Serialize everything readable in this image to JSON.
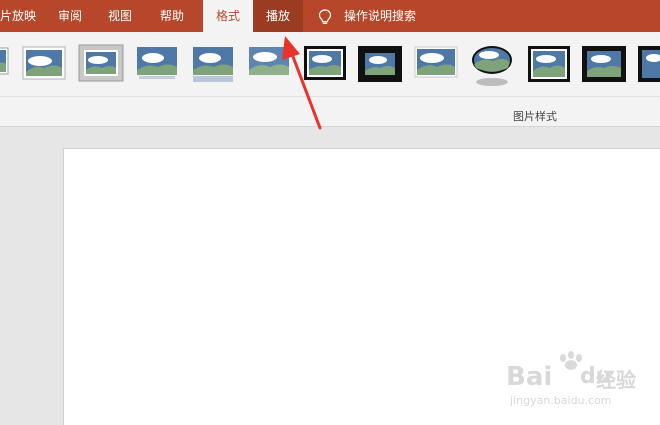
{
  "tabs": [
    {
      "label": "片放映",
      "id": "slideshow"
    },
    {
      "label": "审阅",
      "id": "review"
    },
    {
      "label": "视图",
      "id": "view"
    },
    {
      "label": "帮助",
      "id": "help"
    },
    {
      "label": "格式",
      "id": "format",
      "active": true
    },
    {
      "label": "播放",
      "id": "playback"
    }
  ],
  "search": {
    "label": "操作说明搜索",
    "icon": "lightbulb-icon"
  },
  "ribbon": {
    "group_label": "图片样式",
    "styles": [
      "picture-style-1",
      "picture-style-2",
      "picture-style-3",
      "picture-style-4",
      "picture-style-5",
      "picture-style-6",
      "picture-style-7",
      "picture-style-8",
      "picture-style-9",
      "picture-style-10",
      "picture-style-11",
      "picture-style-12",
      "picture-style-13"
    ]
  },
  "watermark": {
    "line1": "Bai",
    "line2": "du",
    "line3": "经验",
    "url": "jingyan.baidu.com"
  },
  "colors": {
    "accent": "#b7472a",
    "annotation": "#e8332a"
  }
}
